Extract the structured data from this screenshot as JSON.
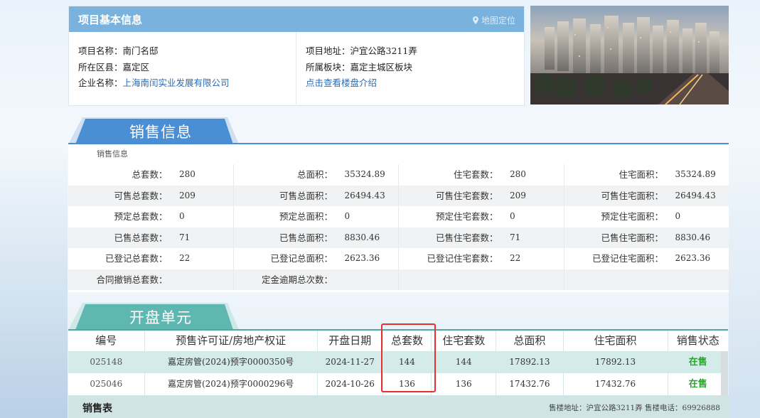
{
  "project": {
    "header_title": "项目基本信息",
    "locate_label": "地图定位",
    "left": [
      {
        "label": "项目名称：",
        "value": "南门名邸"
      },
      {
        "label": "所在区县：",
        "value": "嘉定区"
      },
      {
        "label": "企业名称：",
        "value": "上海南闰实业发展有限公司"
      }
    ],
    "right": [
      {
        "label": "项目地址：",
        "value": "沪宜公路3211弄"
      },
      {
        "label": "所属板块：",
        "value": "嘉定主城区板块"
      }
    ],
    "intro_link": "点击查看楼盘介绍"
  },
  "sales": {
    "tab_title": "销售信息",
    "subtitle": "销售信息",
    "rows": [
      [
        {
          "l": "总套数：",
          "v": "280"
        },
        {
          "l": "总面积：",
          "v": "35324.89"
        },
        {
          "l": "住宅套数：",
          "v": "280"
        },
        {
          "l": "住宅面积：",
          "v": "35324.89"
        }
      ],
      [
        {
          "l": "可售总套数：",
          "v": "209"
        },
        {
          "l": "可售总面积：",
          "v": "26494.43"
        },
        {
          "l": "可售住宅套数：",
          "v": "209"
        },
        {
          "l": "可售住宅面积：",
          "v": "26494.43"
        }
      ],
      [
        {
          "l": "预定总套数：",
          "v": "0"
        },
        {
          "l": "预定总面积：",
          "v": "0"
        },
        {
          "l": "预定住宅套数：",
          "v": "0"
        },
        {
          "l": "预定住宅面积：",
          "v": "0"
        }
      ],
      [
        {
          "l": "已售总套数：",
          "v": "71"
        },
        {
          "l": "已售总面积：",
          "v": "8830.46"
        },
        {
          "l": "已售住宅套数：",
          "v": "71"
        },
        {
          "l": "已售住宅面积：",
          "v": "8830.46"
        }
      ],
      [
        {
          "l": "已登记总套数：",
          "v": "22"
        },
        {
          "l": "已登记总面积：",
          "v": "2623.36"
        },
        {
          "l": "已登记住宅套数：",
          "v": "22"
        },
        {
          "l": "已登记住宅面积：",
          "v": "2623.36"
        }
      ],
      [
        {
          "l": "合同撤销总套数：",
          "v": ""
        },
        {
          "l": "定金逾期总次数：",
          "v": ""
        },
        {
          "l": "",
          "v": ""
        },
        {
          "l": "",
          "v": ""
        }
      ]
    ]
  },
  "units": {
    "tab_title": "开盘单元",
    "headers": [
      "编号",
      "预售许可证/房地产权证",
      "开盘日期",
      "总套数",
      "住宅套数",
      "总面积",
      "住宅面积",
      "销售状态"
    ],
    "rows": [
      [
        "025148",
        "嘉定房管(2024)预字0000350号",
        "2024-11-27",
        "144",
        "144",
        "17892.13",
        "17892.13",
        "在售"
      ],
      [
        "025046",
        "嘉定房管(2024)预字0000296号",
        "2024-10-26",
        "136",
        "136",
        "17432.76",
        "17432.76",
        "在售"
      ]
    ]
  },
  "footer": {
    "title": "销售表",
    "info": "售楼地址：沪宜公路3211弄 售楼电话：69926888"
  },
  "colors": {
    "blue_tab": "#4a8fd4",
    "teal_tab": "#5fb7b1",
    "status_green": "#2aa32d",
    "highlight_red": "#e53030"
  }
}
